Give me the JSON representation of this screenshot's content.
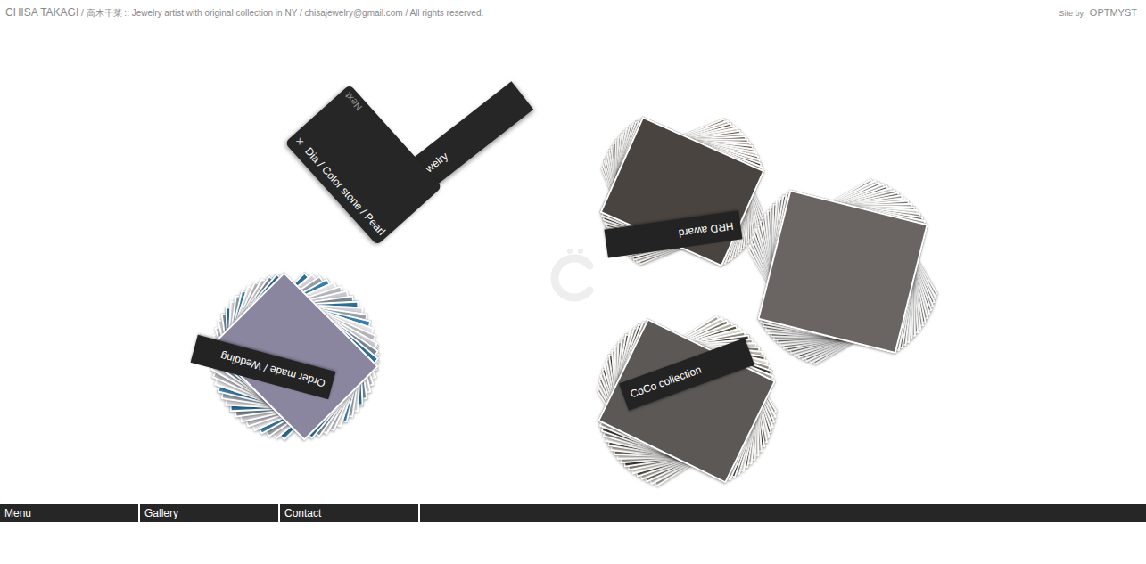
{
  "header": {
    "name": "CHISA TAKAGI",
    "info": " / 高木千菜 :: Jewelry artist with original collection in NY / chisajewelry@gmail.com / All rights reserved."
  },
  "credit": {
    "label": "Site by.",
    "brand": "OPTMYST"
  },
  "menu_card": {
    "next": "Next",
    "close": "×",
    "title": "Dia / Color stone / Pearl",
    "tab": "Art jewelry"
  },
  "stacks": [
    {
      "label": "HRD award"
    },
    {
      "label": null
    },
    {
      "label": "CoCo collection"
    },
    {
      "label": "Order made / Wedding"
    }
  ],
  "nav": [
    {
      "label": "Menu"
    },
    {
      "label": "Gallery"
    },
    {
      "label": "Contact"
    }
  ]
}
